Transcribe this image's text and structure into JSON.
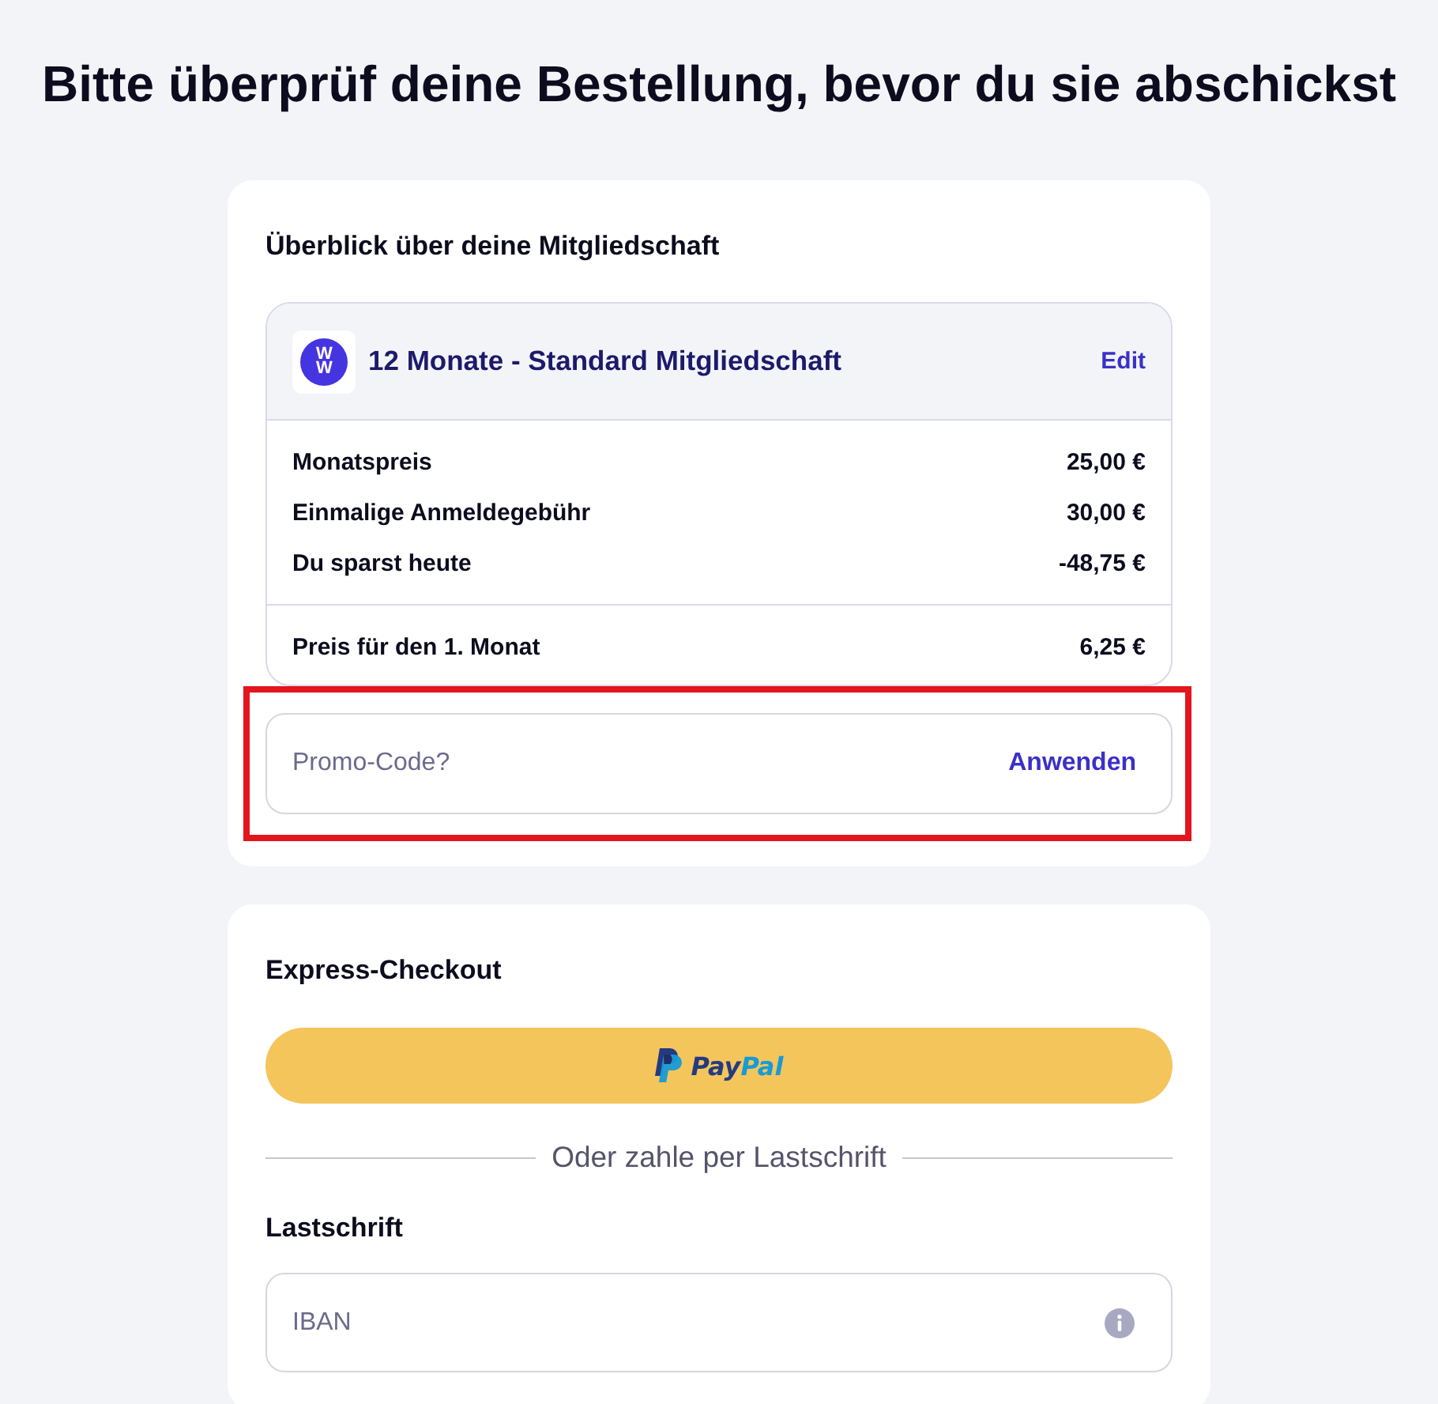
{
  "page_title": "Bitte überprüf deine Bestellung, bevor du sie abschickst",
  "membership_card": {
    "heading": "Überblick über deine Mitgliedschaft",
    "plan": {
      "logo": "WW",
      "name": "12 Monate - Standard Mitgliedschaft",
      "edit": "Edit"
    },
    "price_rows": [
      {
        "label": "Monatspreis",
        "amount": "25,00 €"
      },
      {
        "label": "Einmalige Anmeldegebühr",
        "amount": "30,00 €"
      },
      {
        "label": "Du sparst heute",
        "amount": "-48,75 €"
      }
    ],
    "total": {
      "label": "Preis für den 1. Monat",
      "amount": "6,25 €"
    },
    "promo": {
      "placeholder": "Promo-Code?",
      "apply": "Anwenden",
      "highlighted": true
    }
  },
  "payment_card": {
    "heading": "Express-Checkout",
    "paypal": {
      "wordmark": [
        "Pay",
        "Pal"
      ]
    },
    "divider_text": "Oder zahle per Lastschrift",
    "section_heading": "Lastschrift",
    "iban": {
      "placeholder": "IBAN"
    }
  }
}
